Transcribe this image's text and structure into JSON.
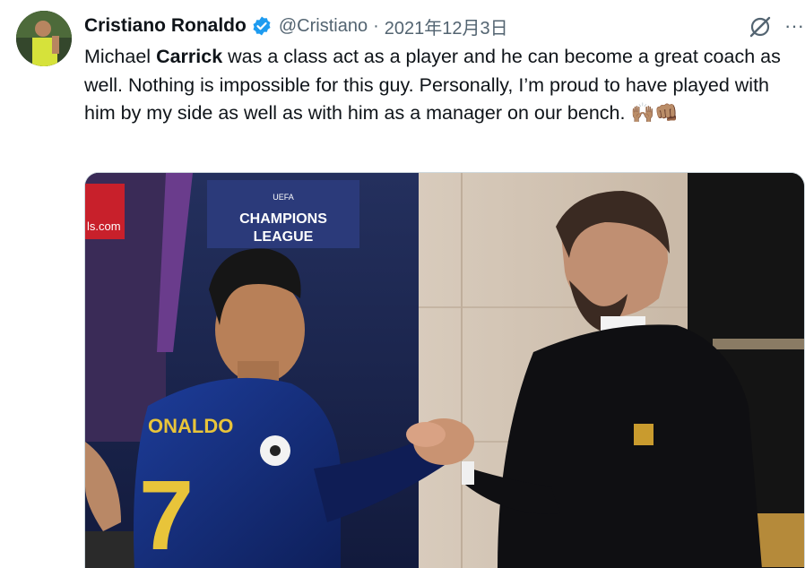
{
  "tweet": {
    "author_name": "Cristiano Ronaldo",
    "handle": "@Cristiano",
    "separator": "·",
    "date": "2021年12月3日",
    "text_pre": "Michael ",
    "text_bold": "Carrick",
    "text_post": " was a class act as a player and he can become a great coach as well. Nothing is impossible for this guy. Personally, I’m proud to have played with him by my side as well as with him as a manager on our bench.",
    "emoji": "🙌🏽👊🏽",
    "more_label": "···"
  },
  "icons": {
    "verified": "verified-badge-icon",
    "grok": "grok-icon",
    "more": "more-icon"
  },
  "media": {
    "signage_brand": "ls.com",
    "champions_league_line1": "CHAMPIONS",
    "champions_league_line2": "LEAGUE",
    "uefa_label": "UEFA",
    "shirt_name": "ONALDO",
    "shirt_number": "7"
  },
  "colors": {
    "verified_blue": "#1d9bf0",
    "secondary_text": "#536471",
    "primary_text": "#0f1419"
  }
}
